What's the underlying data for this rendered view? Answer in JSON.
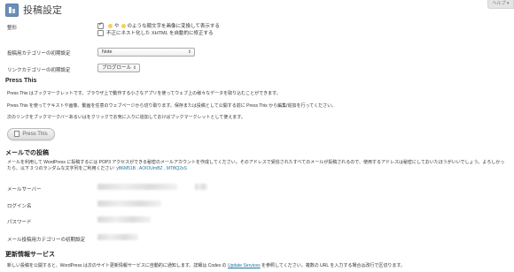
{
  "help_tab": "ヘルプ ▾",
  "page_title": "投稿設定",
  "formatting": {
    "label": "整形",
    "option1": "や",
    "option1b": "のような顔文字を画像に変換して表示する",
    "option2": "不正にネスト化した XHTML を自動的に修正する"
  },
  "default_post_category": {
    "label": "投稿用カテゴリーの初期設定",
    "value": "Note"
  },
  "default_link_category": {
    "label": "リンクカテゴリーの初期設定",
    "value": "ブログロール"
  },
  "press_this": {
    "title": "Press This",
    "p1": "Press This はブックマークレットです。ブラウザ上で動作する小さなアプリを使ってウェブ上の様々なデータを取り込むことができます。",
    "p2": "Press This を使ってテキストや画像、動画を任意のウェブページから切り取ります。保存または投稿として公開する前に Press This から編集/追加を行ってください。",
    "p3": "次のリンクをブックマークバーあるいはをクリックでお気に入りに追加しておけばブックマークレットとして使えます。",
    "button": "Press This"
  },
  "post_via_email": {
    "title": "メールでの投稿",
    "desc": "メールを利用して WordPress に投稿するには POP3 アクセスができる秘密のメールアカウントを作成してください。そのアドレスで受信されたすべてのメールが投稿されるので、使用するアドレスは秘密にしておいたほうがいいでしょう。よろしかったら、以下 3 つのランダムな文字列をご利用ください:",
    "codes": "yB6M51B , AOIOUmBZ , MTBQ2sS",
    "mail_server": "メールサーバー",
    "login_name": "ログイン名",
    "password": "パスワード",
    "email_category": "メール投稿用カテゴリーの初期設定"
  },
  "update_services": {
    "title": "更新情報サービス",
    "desc_a": "新しい投稿を公開すると、WordPress は次のサイト更新情報サービスに自動的に通知します。詳細は Codex の",
    "link": "Update Services",
    "desc_b": "を参照してください。複数の URL を入力する場合は改行で区切ります。"
  }
}
